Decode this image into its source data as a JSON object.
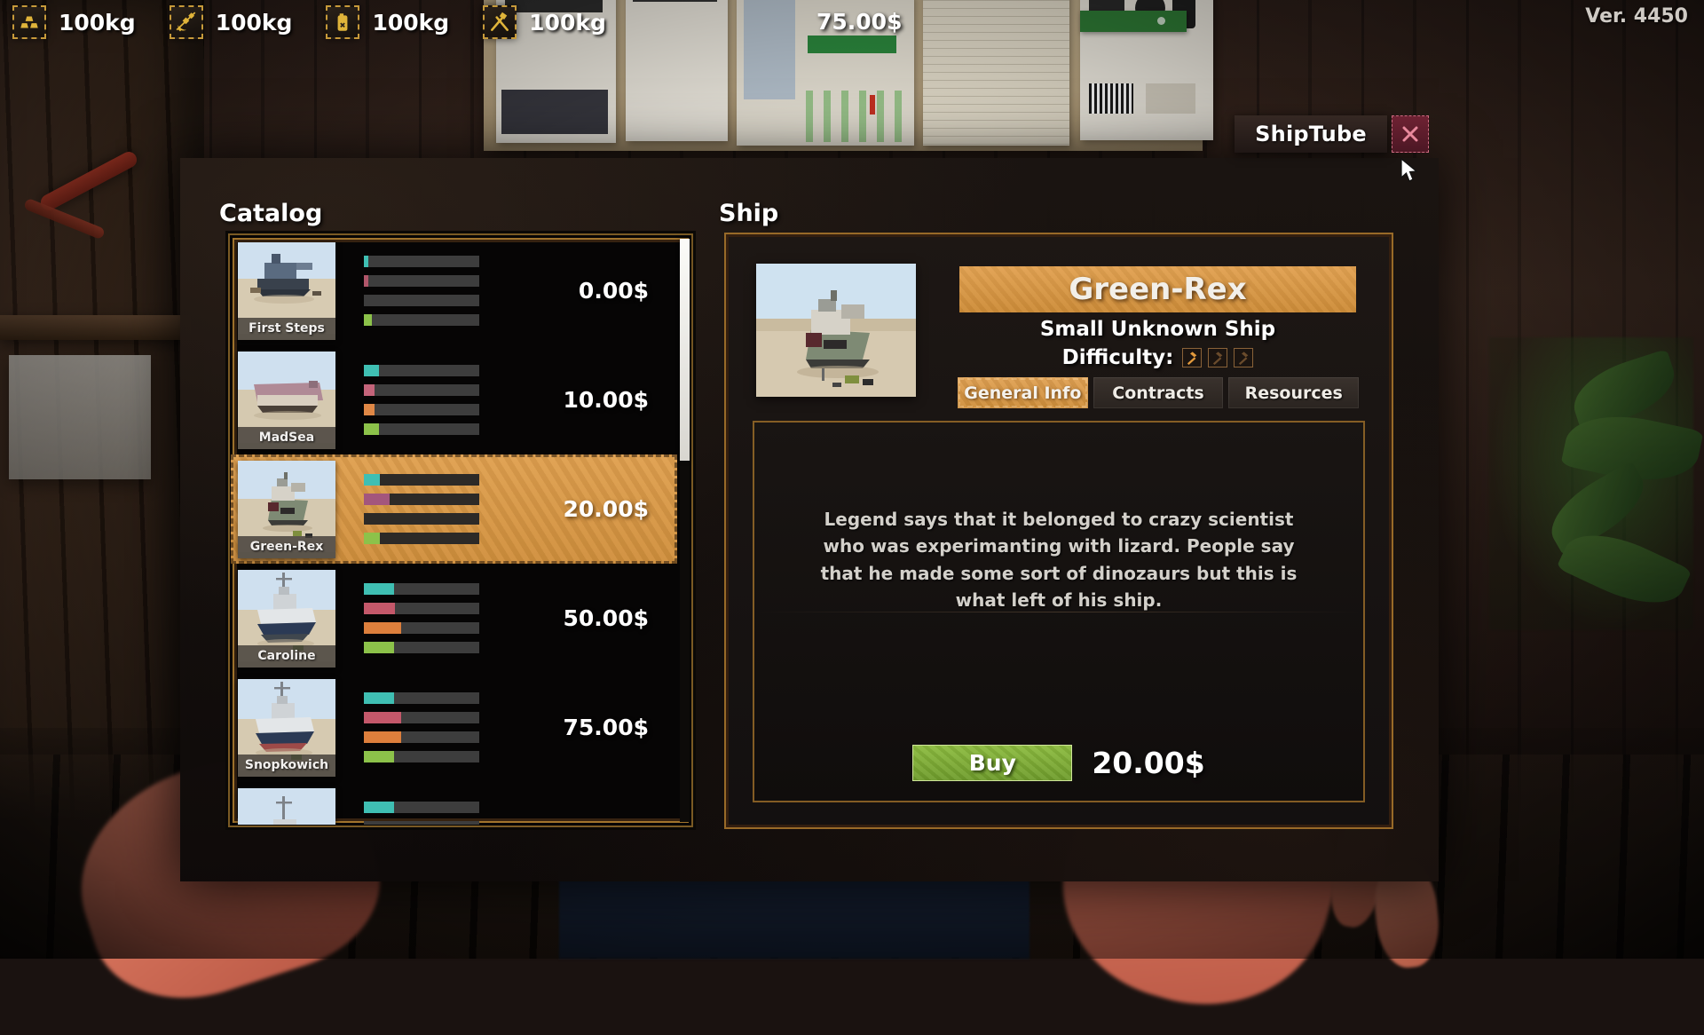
{
  "hud": {
    "resources": [
      {
        "icon": "gold-bars-icon",
        "value": "100kg"
      },
      {
        "icon": "gems-icon",
        "value": "100kg"
      },
      {
        "icon": "fuel-canister-icon",
        "value": "100kg"
      },
      {
        "icon": "tools-icon",
        "value": "100kg"
      }
    ],
    "money": "75.00$",
    "version": "Ver. 4450"
  },
  "window": {
    "title": "ShipTube",
    "close_icon": "close-icon",
    "catalog_heading": "Catalog",
    "ship_heading": "Ship"
  },
  "catalog": {
    "items": [
      {
        "name": "First Steps",
        "price": "0.00$",
        "selected": false,
        "stats": [
          {
            "color": "#3fbfb3",
            "pct": 4
          },
          {
            "color": "#b0566a",
            "pct": 4
          },
          {
            "color": "#e07c3c",
            "pct": 0
          },
          {
            "color": "#8cc24a",
            "pct": 7
          }
        ]
      },
      {
        "name": "MadSea",
        "price": "10.00$",
        "selected": false,
        "stats": [
          {
            "color": "#3fbfb3",
            "pct": 13
          },
          {
            "color": "#c4647a",
            "pct": 9
          },
          {
            "color": "#e08846",
            "pct": 9
          },
          {
            "color": "#8cc24a",
            "pct": 13
          }
        ]
      },
      {
        "name": "Green-Rex",
        "price": "20.00$",
        "selected": true,
        "stats": [
          {
            "color": "#3fbfb3",
            "pct": 14
          },
          {
            "color": "#a3567d",
            "pct": 22
          },
          {
            "color": "#7a6a5a",
            "pct": 0
          },
          {
            "color": "#8cc24a",
            "pct": 14
          }
        ]
      },
      {
        "name": "Caroline",
        "price": "50.00$",
        "selected": false,
        "stats": [
          {
            "color": "#3fbfb3",
            "pct": 26
          },
          {
            "color": "#c4586a",
            "pct": 27
          },
          {
            "color": "#dd7f3c",
            "pct": 32
          },
          {
            "color": "#8cc24a",
            "pct": 26
          }
        ]
      },
      {
        "name": "Snopkowich",
        "price": "75.00$",
        "selected": false,
        "stats": [
          {
            "color": "#3fbfb3",
            "pct": 26
          },
          {
            "color": "#c4586a",
            "pct": 32
          },
          {
            "color": "#dd7f3c",
            "pct": 32
          },
          {
            "color": "#8cc24a",
            "pct": 26
          }
        ]
      },
      {
        "name": "",
        "price": "",
        "selected": false,
        "stats": [
          {
            "color": "#3fbfb3",
            "pct": 26
          },
          {
            "color": "#c4586a",
            "pct": 0
          },
          {
            "color": "#dd7f3c",
            "pct": 0
          },
          {
            "color": "#8cc24a",
            "pct": 0
          }
        ]
      }
    ]
  },
  "ship": {
    "name": "Green-Rex",
    "subtitle": "Small Unknown Ship",
    "difficulty_label": "Difficulty:",
    "difficulty_pips": [
      {
        "icon": "hammer-icon",
        "filled": true
      },
      {
        "icon": "hammer-icon",
        "filled": false
      },
      {
        "icon": "hammer-icon",
        "filled": false
      }
    ],
    "tabs": [
      {
        "label": "General Info",
        "active": true
      },
      {
        "label": "Contracts",
        "active": false
      },
      {
        "label": "Resources",
        "active": false
      }
    ],
    "description": "Legend says that it belonged to crazy scientist who was experimanting with lizard. People say that he made some sort of dinozaurs but this is what left of his ship.",
    "buy_label": "Buy",
    "buy_price": "20.00$"
  },
  "colors": {
    "accent_orange": "#d08f3c",
    "buy_green": "#7fae36",
    "close_red": "#6e2233",
    "frame_gold": "#a8762a"
  }
}
